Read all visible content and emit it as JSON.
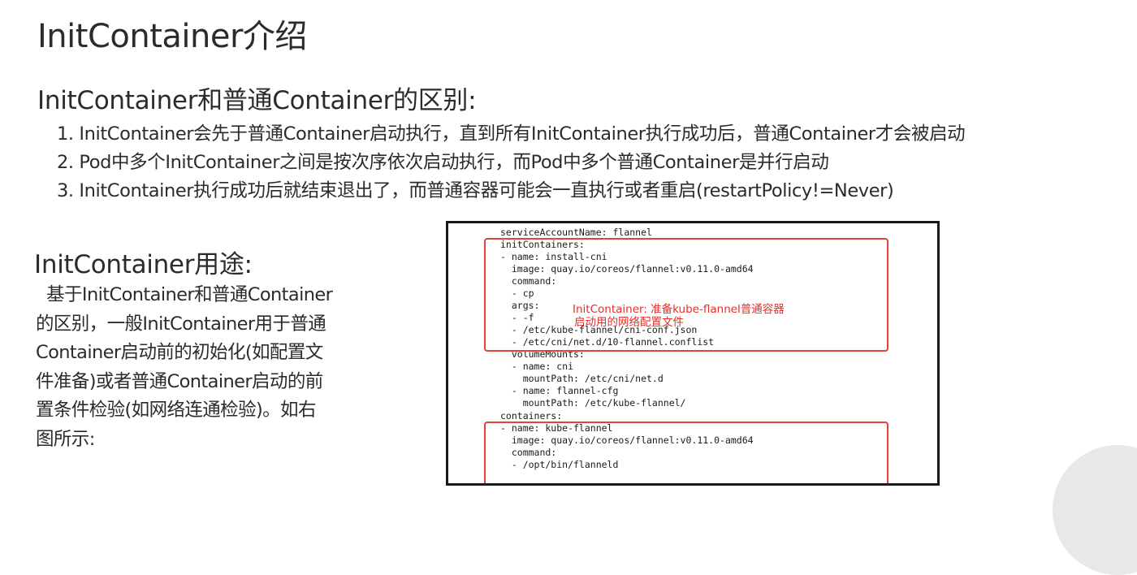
{
  "title": "InitContainer介绍",
  "difference": {
    "heading": "InitContainer和普通Container的区别:",
    "items": [
      "1. InitContainer会先于普通Container启动执行，直到所有InitContainer执行成功后，普通Container才会被启动",
      "2. Pod中多个InitContainer之间是按次序依次启动执行，而Pod中多个普通Container是并行启动",
      "3. InitContainer执行成功后就结束退出了，而普通容器可能会一直执行或者重启(restartPolicy!=Never)"
    ]
  },
  "usage": {
    "heading": "InitContainer用途:",
    "lines": [
      "  基于InitContainer和普通Container",
      "的区别，一般InitContainer用于普通",
      "Container启动前的初始化(如配置文",
      "件准备)或者普通Container启动的前",
      "置条件检验(如网络连通检验)。如右",
      "图所示:"
    ]
  },
  "code": {
    "lines": [
      "serviceAccountName: flannel",
      "initContainers:",
      "- name: install-cni",
      "  image: quay.io/coreos/flannel:v0.11.0-amd64",
      "  command:",
      "  - cp",
      "  args:",
      "  - -f",
      "  - /etc/kube-flannel/cni-conf.json",
      "  - /etc/cni/net.d/10-flannel.conflist",
      "  volumeMounts:",
      "  - name: cni",
      "    mountPath: /etc/cni/net.d",
      "  - name: flannel-cfg",
      "    mountPath: /etc/kube-flannel/",
      "containers:",
      "- name: kube-flannel",
      "  image: quay.io/coreos/flannel:v0.11.0-amd64",
      "  command:",
      "  - /opt/bin/flanneld"
    ],
    "annotation_line1": "InitContainer: 准备kube-flannel普通容器",
    "annotation_line2": "启动用的网络配置文件",
    "highlight_color": "#e0433a"
  }
}
